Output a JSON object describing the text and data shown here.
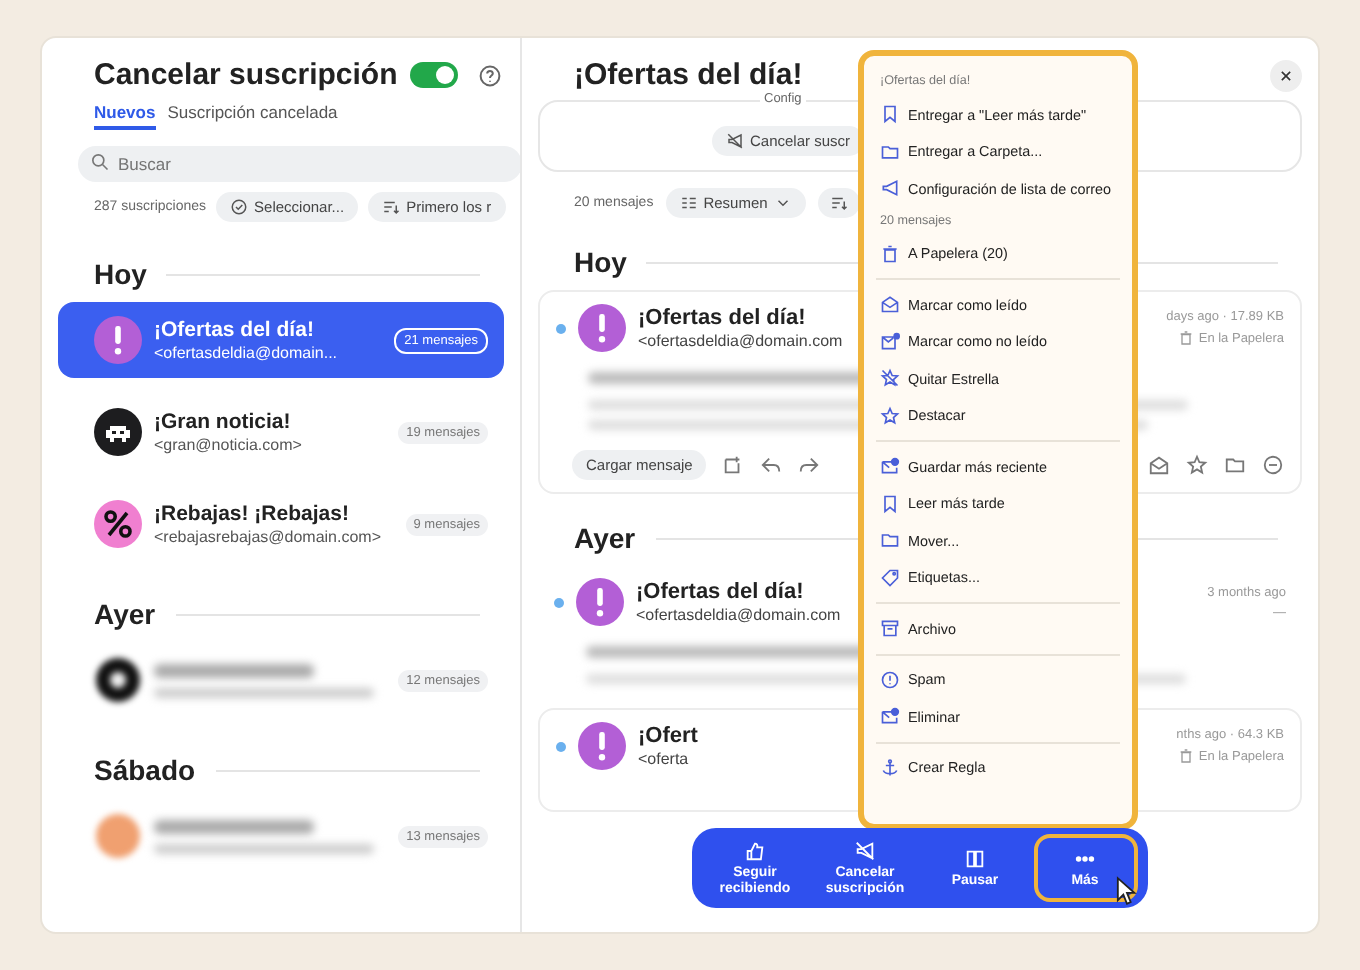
{
  "sidebar": {
    "title": "Cancelar suscripción",
    "toggle_on": true,
    "tabs": [
      {
        "label": "Nuevos",
        "selected": true
      },
      {
        "label": "Suscripción cancelada",
        "selected": false
      }
    ],
    "search": {
      "placeholder": "Buscar"
    },
    "count": "287 suscripciones",
    "select_button": "Seleccionar...",
    "sort_button": "Primero los r",
    "sections": [
      {
        "title": "Hoy",
        "items": [
          {
            "kind": "alert",
            "name": "¡Ofertas del día!",
            "email": "<ofertasdeldia@domain...",
            "count": "21 mensajes",
            "selected": true
          },
          {
            "kind": "invader",
            "name": "¡Gran noticia!",
            "email": "<gran@noticia.com>",
            "count": "19 mensajes",
            "selected": false
          },
          {
            "kind": "percent",
            "name": "¡Rebajas! ¡Rebajas!",
            "email": "<rebajasrebajas@domain.com>",
            "count": "9 mensajes",
            "selected": false
          }
        ]
      },
      {
        "title": "Ayer",
        "items": [
          {
            "kind": "blurred-dark",
            "count": "12 mensajes",
            "selected": false
          }
        ]
      },
      {
        "title": "Sábado",
        "items": [
          {
            "kind": "blurred-orange",
            "count": "13 mensajes",
            "selected": false
          }
        ]
      }
    ]
  },
  "main": {
    "title": "¡Ofertas del día!",
    "config_label": "Config",
    "config_button": "Cancelar suscr",
    "count": "20 mensajes",
    "view_button": "Resumen",
    "sections": [
      {
        "title": "Hoy",
        "messages": [
          {
            "kind": "card",
            "name": "¡Ofertas del día!",
            "email": "<ofertasdeldia@domain.com",
            "time": "days ago · 17.89 KB",
            "status": "En la Papelera",
            "unread": true,
            "load_button": "Cargar mensaje"
          }
        ]
      },
      {
        "title": "Ayer",
        "messages": [
          {
            "kind": "plain",
            "name": "¡Ofertas del día!",
            "email": "<ofertasdeldia@domain.com",
            "time": "3 months ago",
            "status": "—",
            "unread": true
          },
          {
            "kind": "card-cut",
            "name": "¡Ofert",
            "email": "<oferta",
            "time": "nths ago · 64.3 KB",
            "status": "En la Papelera",
            "unread": true
          }
        ]
      }
    ]
  },
  "menu": {
    "header": "¡Ofertas del día!",
    "groups": [
      {
        "items": [
          "Entregar a \"Leer más tarde\"",
          "Entregar a Carpeta...",
          "Configuración de lista de correo"
        ]
      },
      {
        "label": "20 mensajes",
        "items": [
          "A Papelera (20)"
        ]
      },
      {
        "items": [
          "Marcar como leído",
          "Marcar como no leído",
          "Quitar Estrella",
          "Destacar"
        ]
      },
      {
        "items": [
          "Guardar más reciente",
          "Leer más tarde",
          "Mover...",
          "Etiquetas..."
        ]
      },
      {
        "items": [
          "Archivo"
        ]
      },
      {
        "items": [
          "Spam",
          "Eliminar"
        ]
      },
      {
        "items": [
          "Crear Regla"
        ]
      }
    ]
  },
  "action_bar": [
    {
      "label": "Seguir recibiendo",
      "selected": false
    },
    {
      "label": "Cancelar suscripción",
      "selected": false
    },
    {
      "label": "Pausar",
      "selected": false
    },
    {
      "label": "Más",
      "selected": true
    }
  ]
}
